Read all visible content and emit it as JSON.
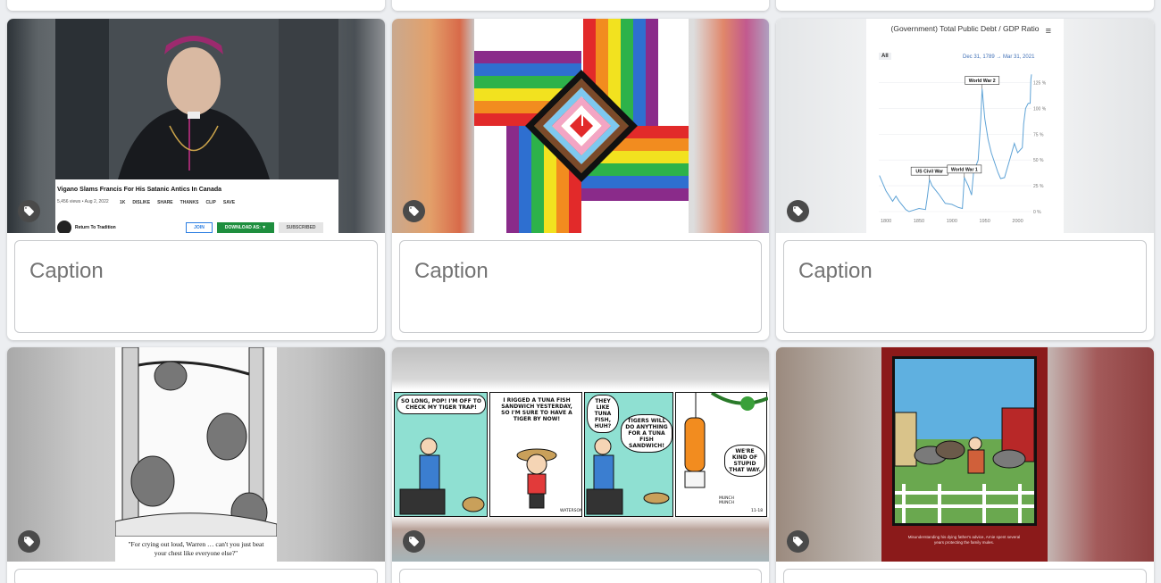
{
  "captions": {
    "placeholder": "Caption"
  },
  "colors": {
    "page_bg": "#eceef1",
    "card_bg": "#ffffff",
    "tag_button": "#4a4a4a",
    "caption_border": "#c7c9cc",
    "caption_text": "#737373"
  },
  "cards": [
    {
      "image_kind": "youtube-screenshot",
      "youtube": {
        "title": "Vigano Slams Francis For His Satanic Antics In Canada",
        "meta": "5,456 views • Aug 2, 2022",
        "like_count": "1K",
        "actions": [
          "DISLIKE",
          "SHARE",
          "THANKS",
          "CLIP",
          "SAVE"
        ],
        "channel": "Return To Tradition",
        "join": "JOIN",
        "download": "DOWNLOAD AS: ▼",
        "subscribed": "SUBSCRIBED"
      },
      "tag_icon": "tag-icon"
    },
    {
      "image_kind": "progress-pride-flag-art",
      "tag_icon": "tag-icon"
    },
    {
      "image_kind": "line-chart-screenshot",
      "tag_icon": "tag-icon"
    },
    {
      "image_kind": "far-side-cartoon",
      "cartoon_caption": "\"For crying out loud, Warren … can't you just beat your chest like everyone else?\"",
      "tag_icon": "tag-icon"
    },
    {
      "image_kind": "calvin-and-hobbes-strip",
      "panels": [
        "SO LONG, POP! I'M OFF TO CHECK MY TIGER TRAP!",
        "I RIGGED A TUNA FISH SANDWICH YESTERDAY, SO I'M SURE TO HAVE A TIGER BY NOW!",
        "THEY LIKE TUNA FISH, HUH?",
        "TIGERS WILL DO ANYTHING FOR A TUNA FISH SANDWICH!",
        "WE'RE KIND OF STUPID THAT WAY."
      ],
      "sound_effect": "MUNCH MUNCH",
      "signature": "WATERSON",
      "date_mark": "11-18",
      "tag_icon": "tag-icon"
    },
    {
      "image_kind": "far-side-framed-cartoon",
      "cartoon_caption": "Misunderstanding his dying father's advice, Arnie spent several years protecting the family mules.",
      "tag_icon": "tag-icon"
    }
  ],
  "chart_data": {
    "type": "line",
    "title": "(Government) Total Public Debt / GDP Ratio",
    "range_selector": "All",
    "date_from": "Dec 31, 1789",
    "date_to": "Mar 31, 2021",
    "x_ticks": [
      "1800",
      "1850",
      "1900",
      "1950",
      "2000"
    ],
    "y_ticks": [
      "0 %",
      "25 %",
      "50 %",
      "75 %",
      "100 %",
      "125 %"
    ],
    "xlim": [
      1789,
      2021
    ],
    "ylim": [
      0,
      135
    ],
    "annotations": [
      {
        "label": "US Civil War",
        "x": 1866,
        "y": 31
      },
      {
        "label": "World War 1",
        "x": 1919,
        "y": 33
      },
      {
        "label": "World War 2",
        "x": 1946,
        "y": 119
      }
    ],
    "series": [
      {
        "x": [
          1790,
          1800,
          1810,
          1815,
          1820,
          1830,
          1835,
          1840,
          1850,
          1860,
          1863,
          1866,
          1870,
          1880,
          1890,
          1900,
          1910,
          1916,
          1919,
          1925,
          1930,
          1933,
          1940,
          1944,
          1946,
          1950,
          1955,
          1960,
          1970,
          1974,
          1980,
          1990,
          1995,
          2000,
          2007,
          2009,
          2012,
          2016,
          2019,
          2020,
          2021
        ],
        "y": [
          35,
          20,
          10,
          15,
          10,
          2,
          0,
          1,
          3,
          2,
          15,
          31,
          25,
          17,
          8,
          7,
          4,
          3,
          33,
          25,
          16,
          38,
          50,
          90,
          119,
          90,
          70,
          57,
          38,
          32,
          33,
          55,
          66,
          57,
          62,
          85,
          100,
          105,
          105,
          128,
          133
        ]
      }
    ]
  }
}
